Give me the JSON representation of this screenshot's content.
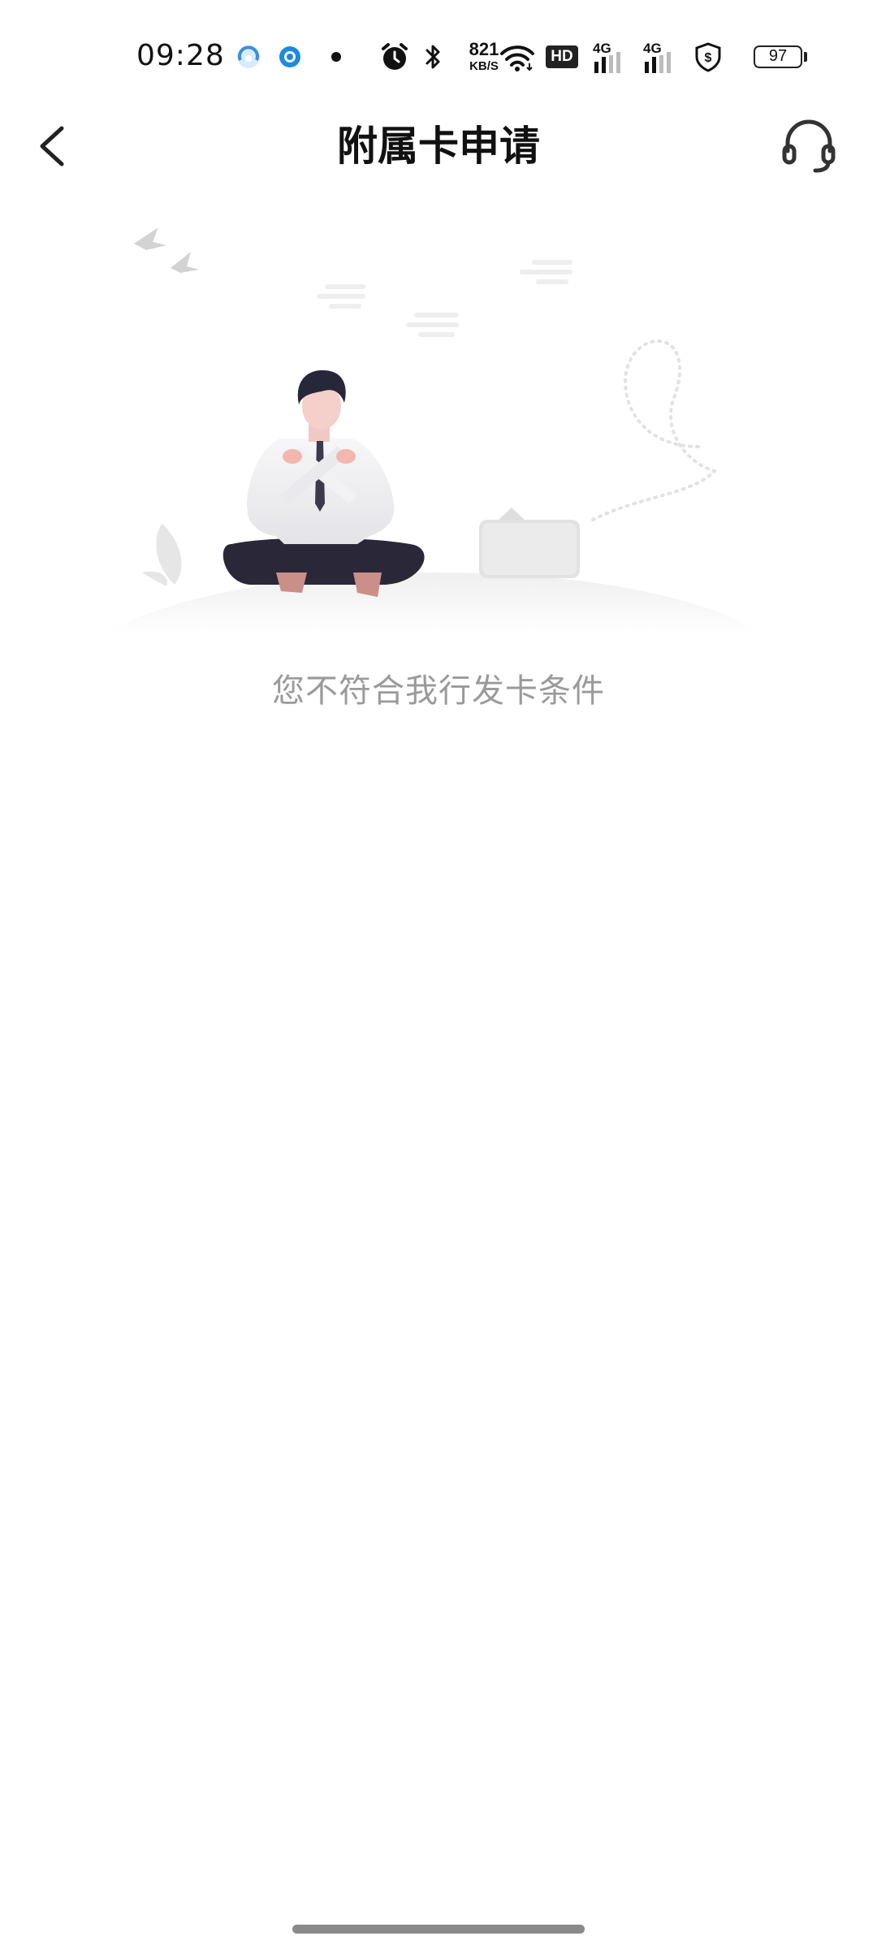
{
  "status_bar": {
    "time": "09:28",
    "net_speed_value": "821",
    "net_speed_unit": "KB/S",
    "hd_label": "HD",
    "signal1_label": "4G",
    "signal2_label": "4G",
    "battery_level": "97",
    "icons": [
      "app-notification-icon",
      "app-notification-icon",
      "dot-icon",
      "alarm-icon",
      "bluetooth-icon",
      "wifi-icon",
      "hd-voice-icon",
      "signal-4g-icon",
      "signal-4g-icon",
      "shield-dollar-icon",
      "battery-icon"
    ]
  },
  "nav": {
    "title": "附属卡申请",
    "back_icon": "chevron-left-icon",
    "service_icon": "headset-icon"
  },
  "empty_state": {
    "message": "您不符合我行发卡条件",
    "illustration": "person-crossed-arms-illustration"
  },
  "colors": {
    "background": "#ffffff",
    "title": "#111111",
    "message": "#9a9a9a"
  }
}
